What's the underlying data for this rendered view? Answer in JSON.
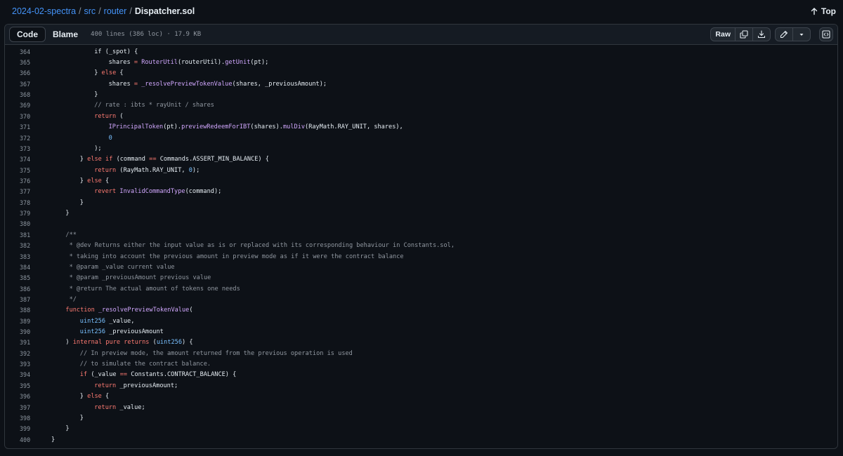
{
  "breadcrumb": {
    "repo": "2024-02-spectra",
    "sep": "/",
    "dir1": "src",
    "dir2": "router",
    "file": "Dispatcher.sol"
  },
  "top": {
    "label": "Top",
    "icon": "arrow-up-icon"
  },
  "header": {
    "tab_code": "Code",
    "tab_blame": "Blame",
    "file_info": "400 lines (386 loc) · 17.9 KB",
    "raw_label": "Raw",
    "icons": [
      "copy-icon",
      "download-icon",
      "pencil-icon",
      "chevron-down-icon",
      "symbols-icon"
    ]
  },
  "colors": {
    "background": "#0d1117",
    "keyword": "#ff7b72",
    "function": "#d2a8ff",
    "type": "#79c0ff",
    "comment": "#9198a1",
    "link": "#4493f8"
  },
  "code": {
    "lines": [
      {
        "n": "364",
        "i": 6,
        "t": [
          [
            "if (_spot) {",
            ""
          ]
        ]
      },
      {
        "n": "365",
        "i": 8,
        "t": [
          [
            "shares ",
            ""
          ],
          [
            "=",
            "op"
          ],
          [
            " ",
            ""
          ],
          [
            "RouterUtil",
            "fn"
          ],
          [
            "(routerUtil).",
            ""
          ],
          [
            "getUnit",
            "fn"
          ],
          [
            "(pt);",
            ""
          ]
        ]
      },
      {
        "n": "366",
        "i": 6,
        "t": [
          [
            "} ",
            ""
          ],
          [
            "else",
            "kw"
          ],
          [
            " {",
            ""
          ]
        ]
      },
      {
        "n": "367",
        "i": 8,
        "t": [
          [
            "shares ",
            ""
          ],
          [
            "=",
            "op"
          ],
          [
            " ",
            ""
          ],
          [
            "_resolvePreviewTokenValue",
            "fn"
          ],
          [
            "(shares, _previousAmount);",
            ""
          ]
        ]
      },
      {
        "n": "368",
        "i": 6,
        "t": [
          [
            "}",
            ""
          ]
        ]
      },
      {
        "n": "369",
        "i": 6,
        "t": [
          [
            "// rate : ibts * rayUnit / shares",
            "cm"
          ]
        ]
      },
      {
        "n": "370",
        "i": 6,
        "t": [
          [
            "return",
            "kw"
          ],
          [
            " (",
            ""
          ]
        ]
      },
      {
        "n": "371",
        "i": 8,
        "t": [
          [
            "IPrincipalToken",
            "fn"
          ],
          [
            "(pt).",
            ""
          ],
          [
            "previewRedeemForIBT",
            "fn"
          ],
          [
            "(shares).",
            ""
          ],
          [
            "mulDiv",
            "fn"
          ],
          [
            "(RayMath.RAY_UNIT, shares),",
            ""
          ]
        ]
      },
      {
        "n": "372",
        "i": 8,
        "t": [
          [
            "0",
            "num"
          ]
        ]
      },
      {
        "n": "373",
        "i": 6,
        "t": [
          [
            ");",
            ""
          ]
        ]
      },
      {
        "n": "374",
        "i": 4,
        "t": [
          [
            "} ",
            ""
          ],
          [
            "else",
            "kw"
          ],
          [
            " ",
            ""
          ],
          [
            "if",
            "kw"
          ],
          [
            " (command ",
            ""
          ],
          [
            "==",
            "op"
          ],
          [
            " Commands.ASSERT_MIN_BALANCE) {",
            ""
          ]
        ]
      },
      {
        "n": "375",
        "i": 6,
        "t": [
          [
            "return",
            "kw"
          ],
          [
            " (RayMath.RAY_UNIT, ",
            ""
          ],
          [
            "0",
            "num"
          ],
          [
            ");",
            ""
          ]
        ]
      },
      {
        "n": "376",
        "i": 4,
        "t": [
          [
            "} ",
            ""
          ],
          [
            "else",
            "kw"
          ],
          [
            " {",
            ""
          ]
        ]
      },
      {
        "n": "377",
        "i": 6,
        "t": [
          [
            "revert",
            "kw"
          ],
          [
            " ",
            ""
          ],
          [
            "InvalidCommandType",
            "fn"
          ],
          [
            "(command);",
            ""
          ]
        ]
      },
      {
        "n": "378",
        "i": 4,
        "t": [
          [
            "}",
            ""
          ]
        ]
      },
      {
        "n": "379",
        "i": 2,
        "t": [
          [
            "}",
            ""
          ]
        ]
      },
      {
        "n": "380",
        "i": 0,
        "t": []
      },
      {
        "n": "381",
        "i": 2,
        "t": [
          [
            "/**",
            "cm"
          ]
        ]
      },
      {
        "n": "382",
        "i": 2,
        "t": [
          [
            " * @dev Returns either the input value as is or replaced with its corresponding behaviour in Constants.sol,",
            "cm"
          ]
        ]
      },
      {
        "n": "383",
        "i": 2,
        "t": [
          [
            " * taking into account the previous amount in preview mode as if it were the contract balance",
            "cm"
          ]
        ]
      },
      {
        "n": "384",
        "i": 2,
        "t": [
          [
            " * @param _value current value",
            "cm"
          ]
        ]
      },
      {
        "n": "385",
        "i": 2,
        "t": [
          [
            " * @param _previousAmount previous value",
            "cm"
          ]
        ]
      },
      {
        "n": "386",
        "i": 2,
        "t": [
          [
            " * @return The actual amount of tokens one needs",
            "cm"
          ]
        ]
      },
      {
        "n": "387",
        "i": 2,
        "t": [
          [
            " */",
            "cm"
          ]
        ]
      },
      {
        "n": "388",
        "i": 2,
        "t": [
          [
            "function",
            "kw"
          ],
          [
            " ",
            ""
          ],
          [
            "_resolvePreviewTokenValue",
            "fn"
          ],
          [
            "(",
            ""
          ]
        ]
      },
      {
        "n": "389",
        "i": 4,
        "t": [
          [
            "uint256",
            "ty"
          ],
          [
            " _value,",
            ""
          ]
        ]
      },
      {
        "n": "390",
        "i": 4,
        "t": [
          [
            "uint256",
            "ty"
          ],
          [
            " _previousAmount",
            ""
          ]
        ]
      },
      {
        "n": "391",
        "i": 2,
        "t": [
          [
            ") ",
            ""
          ],
          [
            "internal",
            "kw"
          ],
          [
            " ",
            ""
          ],
          [
            "pure",
            "kw"
          ],
          [
            " ",
            ""
          ],
          [
            "returns",
            "kw"
          ],
          [
            " (",
            ""
          ],
          [
            "uint256",
            "ty"
          ],
          [
            ") {",
            ""
          ]
        ]
      },
      {
        "n": "392",
        "i": 4,
        "t": [
          [
            "// In preview mode, the amount returned from the previous operation is used",
            "cm"
          ]
        ]
      },
      {
        "n": "393",
        "i": 4,
        "t": [
          [
            "// to simulate the contract balance.",
            "cm"
          ]
        ]
      },
      {
        "n": "394",
        "i": 4,
        "t": [
          [
            "if",
            "kw"
          ],
          [
            " (_value ",
            ""
          ],
          [
            "==",
            "op"
          ],
          [
            " Constants.CONTRACT_BALANCE) {",
            ""
          ]
        ]
      },
      {
        "n": "395",
        "i": 6,
        "t": [
          [
            "return",
            "kw"
          ],
          [
            " _previousAmount;",
            ""
          ]
        ]
      },
      {
        "n": "396",
        "i": 4,
        "t": [
          [
            "} ",
            ""
          ],
          [
            "else",
            "kw"
          ],
          [
            " {",
            ""
          ]
        ]
      },
      {
        "n": "397",
        "i": 6,
        "t": [
          [
            "return",
            "kw"
          ],
          [
            " _value;",
            ""
          ]
        ]
      },
      {
        "n": "398",
        "i": 4,
        "t": [
          [
            "}",
            ""
          ]
        ]
      },
      {
        "n": "399",
        "i": 2,
        "t": [
          [
            "}",
            ""
          ]
        ]
      },
      {
        "n": "400",
        "i": 0,
        "t": [
          [
            "}",
            ""
          ]
        ]
      }
    ]
  }
}
